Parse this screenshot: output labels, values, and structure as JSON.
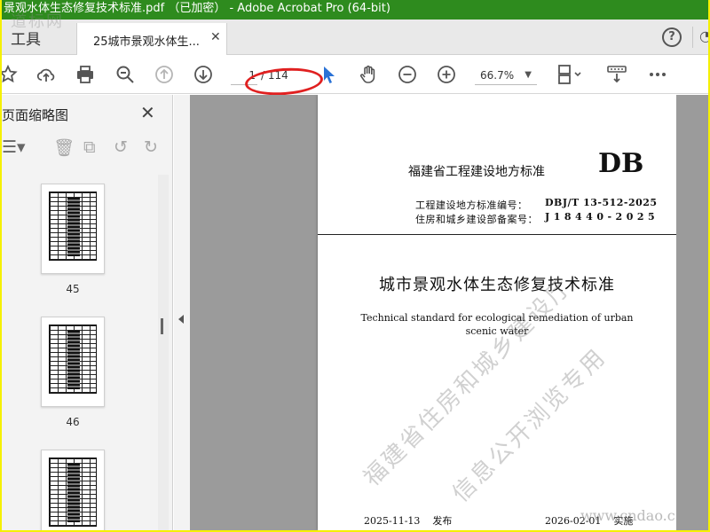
{
  "window": {
    "title": "景观水体生态修复技术标准.pdf （已加密） - Adobe Acrobat Pro (64-bit)"
  },
  "tabs": {
    "tools_label": "工具",
    "document_tab_label": "25城市景观水体生..."
  },
  "toolbar": {
    "current_page": "1",
    "total_pages": "/ 114",
    "zoom_level": "66.7%"
  },
  "thumbnail_panel": {
    "title": "页面缩略图",
    "thumbnails": [
      {
        "page": "45"
      },
      {
        "page": "46"
      },
      {
        "page": ""
      }
    ]
  },
  "document": {
    "org_heading": "福建省工程建设地方标准",
    "db_mark": "DB",
    "std_number_label": "工程建设地方标准编号：",
    "std_number_value": "DBJ/T 13-512-2025",
    "record_label": "住房和城乡建设部备案号：",
    "record_value": "J18440-2025",
    "title_cn": "城市景观水体生态修复技术标准",
    "title_en": "Technical standard for ecological remediation of urban scenic water",
    "issue_date": "2025-11-13",
    "issue_label": "发布",
    "effective_date": "2026-02-01",
    "effective_label": "实施",
    "watermark_line1": "福建省住房和城乡建设厅",
    "watermark_line2": "信息公开浏览专用"
  },
  "overlay": {
    "site_watermark": "www.cndao.c",
    "logo_watermark": "道标网"
  },
  "colors": {
    "title_bar": "#2e8b1e",
    "outer_border": "#f5f000",
    "annotation_ellipse": "#e02020",
    "doc_background": "#9b9b9b"
  }
}
